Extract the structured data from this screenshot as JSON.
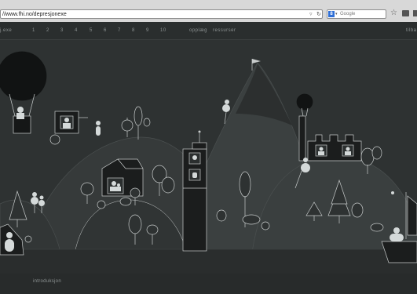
{
  "browser": {
    "url": "//www.fhi.no/depresjonexe",
    "search_engine_label": "8",
    "search_placeholder": "Google"
  },
  "nav": {
    "home_label": "j.exe",
    "chapters": [
      "1",
      "2",
      "3",
      "4",
      "5",
      "6",
      "7",
      "8",
      "9",
      "10"
    ],
    "oppleg_label": "opplæg",
    "ressurser_label": "ressurser",
    "right_label": "tilba"
  },
  "footer": {
    "intro_label": "introduksjon"
  },
  "colors": {
    "background": "#2e3232",
    "hill": "#3b4040",
    "hill_dark": "#262929",
    "ground": "#232525",
    "line": "#c8cccc",
    "accent_pale": "#d4d9d9"
  },
  "icons": {
    "reload": "reload-icon",
    "bookmark": "star-icon",
    "balloon": "hot-air-balloon-icon",
    "boat": "sailboat-icon",
    "flag": "flag-icon"
  }
}
